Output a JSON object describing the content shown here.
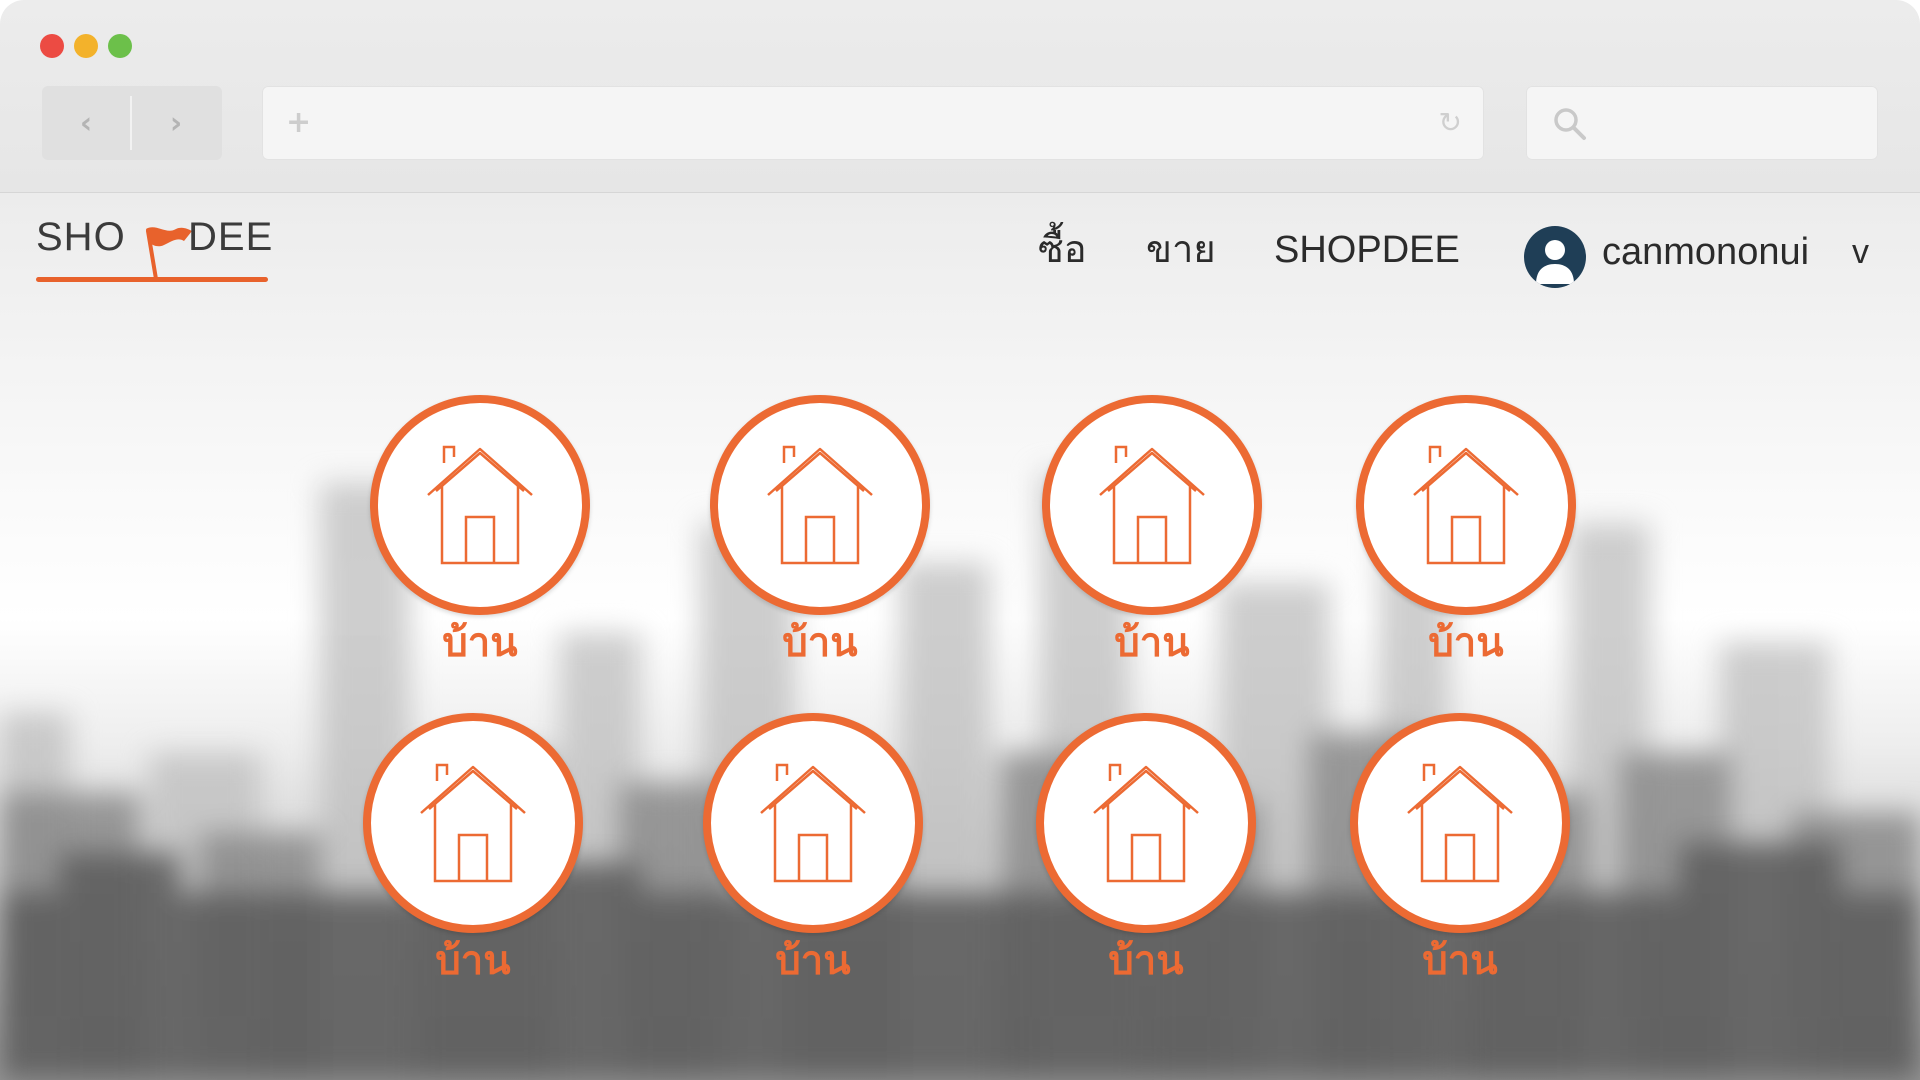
{
  "browser": {
    "back_icon": "‹",
    "forward_icon": "›",
    "new_tab_icon": "+",
    "reload_icon": "↻",
    "address": "",
    "search": ""
  },
  "logo": {
    "left": "SHO",
    "right": "DEE"
  },
  "nav": {
    "buy": "ซื้อ",
    "sell": "ขาย",
    "brand": "SHOPDEE"
  },
  "user": {
    "name": "canmononui",
    "caret": "v"
  },
  "categories": [
    {
      "label": "บ้าน",
      "icon": "house-icon"
    },
    {
      "label": "บ้าน",
      "icon": "house-icon"
    },
    {
      "label": "บ้าน",
      "icon": "house-icon"
    },
    {
      "label": "บ้าน",
      "icon": "house-icon"
    },
    {
      "label": "บ้าน",
      "icon": "house-icon"
    },
    {
      "label": "บ้าน",
      "icon": "house-icon"
    },
    {
      "label": "บ้าน",
      "icon": "house-icon"
    },
    {
      "label": "บ้าน",
      "icon": "house-icon"
    }
  ],
  "colors": {
    "accent": "#ec6a33",
    "close": "#ec4b43",
    "minimize": "#f3b22b",
    "zoom": "#6cc04a",
    "avatar_bg": "#1f3e56"
  }
}
